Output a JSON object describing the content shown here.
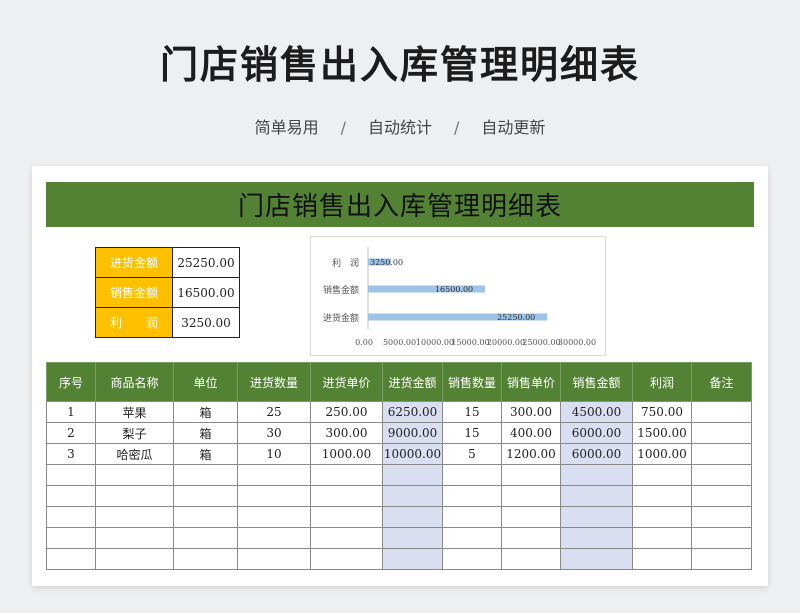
{
  "header": {
    "title": "门店销售出入库管理明细表",
    "tags": [
      "简单易用",
      "自动统计",
      "自动更新"
    ],
    "separator": "/"
  },
  "sheet": {
    "banner": "门店销售出入库管理明细表",
    "summary": [
      {
        "label": "进货金额",
        "value": "25250.00"
      },
      {
        "label": "销售金额",
        "value": "16500.00"
      },
      {
        "label": "利　　润",
        "value": "3250.00"
      }
    ],
    "chart_data": {
      "type": "bar",
      "orientation": "horizontal",
      "categories": [
        "利　润",
        "销售金额",
        "进货金额"
      ],
      "values": [
        3250,
        16500,
        25250
      ],
      "data_labels": [
        "3250.00",
        "16500.00",
        "25250.00"
      ],
      "x_ticks": [
        "0.00",
        "5000.00",
        "10000.00",
        "15000.00",
        "20000.00",
        "25000.00",
        "30000.00"
      ],
      "xlim": [
        0,
        30000
      ],
      "bar_color": "#9dc3e6",
      "title": "",
      "xlabel": "",
      "ylabel": ""
    },
    "table": {
      "columns": [
        "序号",
        "商品名称",
        "单位",
        "进货数量",
        "进货单价",
        "进货金额",
        "销售数量",
        "销售单价",
        "销售金额",
        "利润",
        "备注"
      ],
      "rows": [
        [
          "1",
          "苹果",
          "箱",
          "25",
          "250.00",
          "6250.00",
          "15",
          "300.00",
          "4500.00",
          "750.00",
          ""
        ],
        [
          "2",
          "梨子",
          "箱",
          "30",
          "300.00",
          "9000.00",
          "15",
          "400.00",
          "6000.00",
          "1500.00",
          ""
        ],
        [
          "3",
          "哈密瓜",
          "箱",
          "10",
          "1000.00",
          "10000.00",
          "5",
          "1200.00",
          "6000.00",
          "1000.00",
          ""
        ],
        [
          "",
          "",
          "",
          "",
          "",
          "",
          "",
          "",
          "",
          "",
          ""
        ],
        [
          "",
          "",
          "",
          "",
          "",
          "",
          "",
          "",
          "",
          "",
          ""
        ],
        [
          "",
          "",
          "",
          "",
          "",
          "",
          "",
          "",
          "",
          "",
          ""
        ],
        [
          "",
          "",
          "",
          "",
          "",
          "",
          "",
          "",
          "",
          "",
          ""
        ],
        [
          "",
          "",
          "",
          "",
          "",
          "",
          "",
          "",
          "",
          "",
          ""
        ]
      ]
    },
    "colors": {
      "header_green": "#548235",
      "label_yellow": "#ffc000",
      "highlight_blue": "#d9dff1"
    }
  }
}
